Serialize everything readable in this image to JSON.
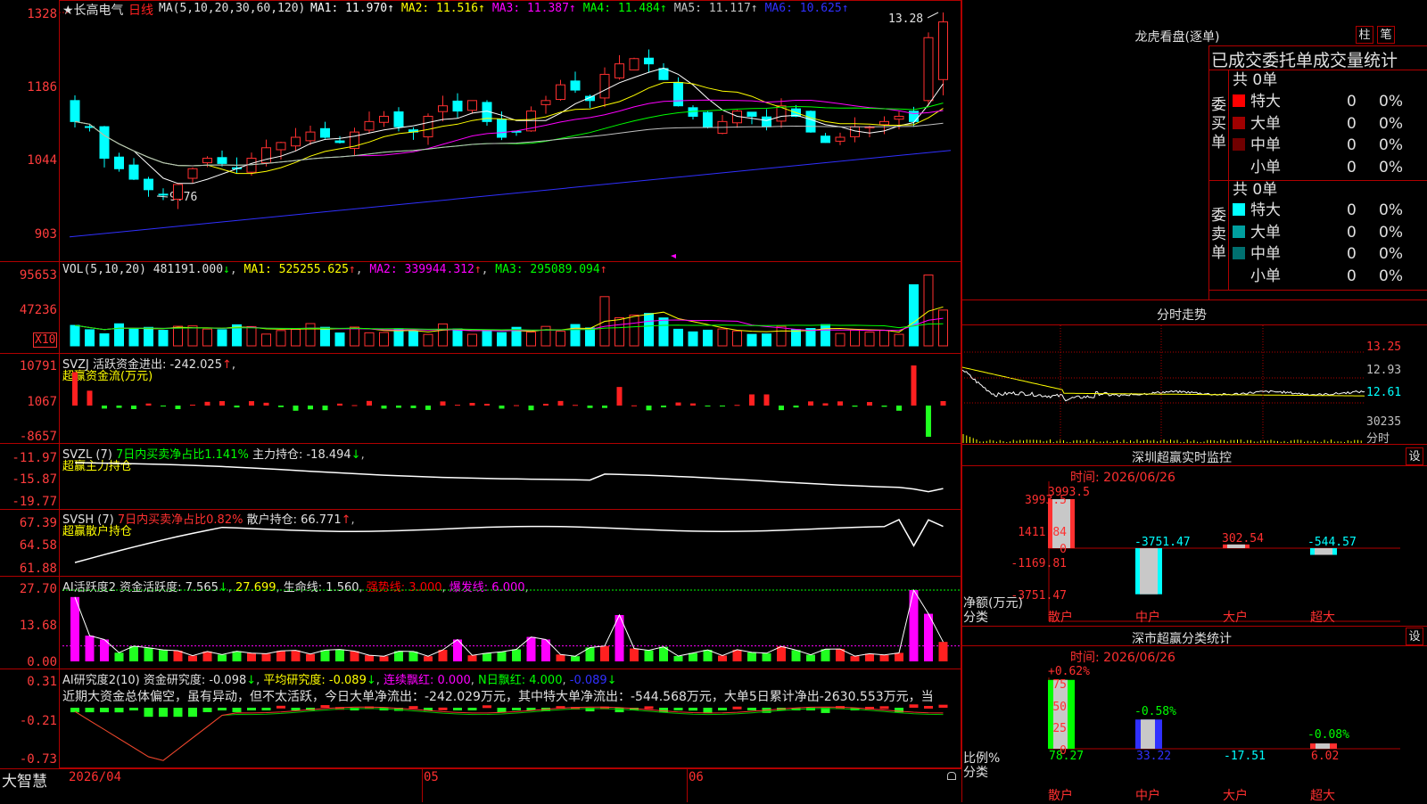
{
  "app": {
    "name": "大智慧"
  },
  "main_chart": {
    "stock_name": "★长高电气",
    "period": "日线",
    "ma_header": "MA(5,10,20,30,60,120)",
    "ma": [
      {
        "label": "MA1: 11.970",
        "arrow": "↑",
        "color": "#ffffff"
      },
      {
        "label": "MA2: 11.516",
        "arrow": "↑",
        "color": "#ffff00"
      },
      {
        "label": "MA3: 11.387",
        "arrow": "↑",
        "color": "#ff00ff"
      },
      {
        "label": "MA4: 11.484",
        "arrow": "↑",
        "color": "#00ff00"
      },
      {
        "label": "MA5: 11.117",
        "arrow": "↑",
        "color": "#c0c0c0"
      },
      {
        "label": "MA6: 10.625",
        "arrow": "↑",
        "color": "#3030ff"
      }
    ],
    "y_ticks": [
      "1328",
      "1186",
      "1044",
      "903"
    ],
    "high_label": "13.28",
    "low_label": "9.76"
  },
  "vol_panel": {
    "header": "VOL(5,10,20)",
    "value": "481191.000",
    "ma": [
      {
        "label": "MA1: 525255.625",
        "color": "#ffff00"
      },
      {
        "label": "MA2: 339944.312",
        "color": "#ff00ff"
      },
      {
        "label": "MA3: 295089.094",
        "color": "#00ff00"
      }
    ],
    "y_ticks": [
      "95653",
      "47236"
    ],
    "unit": "X10"
  },
  "svzj_panel": {
    "header": "SVZJ  活跃资金进出: -242.025",
    "subtitle": "超赢资金流(万元)",
    "y_ticks": [
      "10791",
      "1067",
      "-8657"
    ]
  },
  "svzl_panel": {
    "header1": "SVZL (7)",
    "header2": "7日内买卖净占比1.141%",
    "header3": "主力持仓: -18.494",
    "subtitle": "超赢主力持仓",
    "y_ticks": [
      "-11.97",
      "-15.87",
      "-19.77"
    ]
  },
  "svsh_panel": {
    "header1": "SVSH (7)",
    "header2": "7日内买卖净占比0.82%",
    "header3": "散户持仓: 66.771",
    "subtitle": "超赢散户持仓",
    "y_ticks": [
      "67.39",
      "64.58",
      "61.88"
    ]
  },
  "ai_active_panel": {
    "h1": "AI活跃度2 资金活跃度: 7.565",
    "h2": "27.699",
    "h3": "生命线: 1.560",
    "h4": "强势线: 3.000",
    "h5": "爆发线: 6.000",
    "y_ticks": [
      "27.70",
      "13.68",
      "0.00"
    ]
  },
  "ai_research_panel": {
    "h1": "AI研究度2(10) 资金研究度: -0.098",
    "h2": "平均研究度: -0.089",
    "h3": "连续飘红: 0.000",
    "h4": "N日飘红: 4.000",
    "h5": "-0.089",
    "comment": "近期大资金总体偏空，虽有异动，但不太活跃，今日大单净流出：-242.029万元，其中特大单净流出：-544.568万元，大单5日累计净出-2630.553万元，当",
    "y_ticks": [
      "0.31",
      "-0.21",
      "-0.73"
    ]
  },
  "x_axis": {
    "labels": [
      "2026/04",
      "05",
      "06"
    ]
  },
  "dragon_tiger": {
    "title": "龙虎看盘(逐单)",
    "btn1": "柱",
    "btn2": "笔",
    "subtitle": "已成交委托单成交量统计",
    "buy_label": "委买单",
    "sell_label": "委卖单",
    "buy_total": "共 0单",
    "sell_total": "共 0单",
    "buy_rows": [
      {
        "name": "特大",
        "count": "0",
        "pct": "0%",
        "color": "#ff0000"
      },
      {
        "name": "大单",
        "count": "0",
        "pct": "0%",
        "color": "#a00000"
      },
      {
        "name": "中单",
        "count": "0",
        "pct": "0%",
        "color": "#700000"
      },
      {
        "name": "小单",
        "count": "0",
        "pct": "0%",
        "color": "#000000"
      }
    ],
    "sell_rows": [
      {
        "name": "特大",
        "count": "0",
        "pct": "0%",
        "color": "#00ffff"
      },
      {
        "name": "大单",
        "count": "0",
        "pct": "0%",
        "color": "#00a0a0"
      },
      {
        "name": "中单",
        "count": "0",
        "pct": "0%",
        "color": "#007070"
      },
      {
        "name": "小单",
        "count": "0",
        "pct": "0%",
        "color": "#000000"
      }
    ]
  },
  "intraday": {
    "title": "分时走势",
    "y_ticks": [
      "13.25",
      "12.93",
      "12.61",
      "30235"
    ],
    "bottom_label": "分时"
  },
  "sz_monitor": {
    "title": "深圳超赢实时监控",
    "setting": "设",
    "time": "时间: 2026/06/26",
    "y_ticks": [
      "3993.5",
      "1411.84",
      "0",
      "-1169.81",
      "-3751.47"
    ],
    "y_title": "净额(万元)",
    "x_title": "分类",
    "categories": [
      "散户",
      "中户",
      "大户",
      "超大"
    ],
    "values": [
      3993.5,
      -3751.47,
      302.54,
      -544.57
    ],
    "value_labels": [
      "3993.5",
      "-3751.47",
      "302.54",
      "-544.57"
    ]
  },
  "sz_class": {
    "title": "深市超赢分类统计",
    "setting": "设",
    "time": "时间: 2026/06/26",
    "y_ticks": [
      "75",
      "50",
      "25",
      "0"
    ],
    "y_title": "比例%",
    "x_title": "分类",
    "categories": [
      "散户",
      "中户",
      "大户",
      "超大"
    ],
    "pct_labels": [
      "+0.62%",
      "-0.58%",
      "",
      "-0.08%"
    ],
    "bottom_values": [
      "78.27",
      "33.22",
      "-17.51",
      "6.02"
    ]
  }
}
